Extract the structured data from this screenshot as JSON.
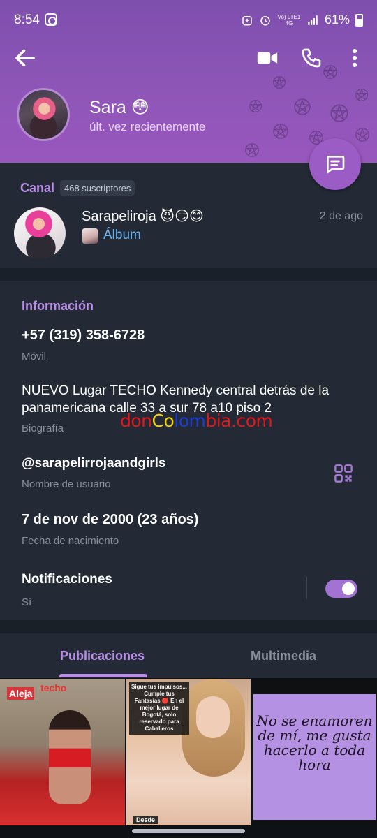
{
  "status_bar": {
    "time": "8:54",
    "network": "Vo) LTE1 4G",
    "battery": "61%"
  },
  "profile": {
    "name": "Sara 😳",
    "last_seen": "últ. vez recientemente"
  },
  "channel": {
    "label": "Canal",
    "subscribers": "468 suscriptores",
    "name": "Sarapeliroja 😈😏😊",
    "date": "2 de ago",
    "last_message": "Álbum"
  },
  "info": {
    "title": "Información",
    "phone": "+57 (319) 358-6728",
    "phone_label": "Móvil",
    "bio": "NUEVO Lugar TECHO Kennedy central detrás de la panamericana calle 33 a sur 78 a10 piso 2",
    "bio_label": "Biografía",
    "username": "@sarapelirrojaandgirls",
    "username_label": "Nombre de usuario",
    "birthdate": "7 de nov de 2000 (23 años)",
    "birthdate_label": "Fecha de nacimiento",
    "notifications": "Notificaciones",
    "notifications_value": "Sí",
    "notifications_enabled": true
  },
  "watermark": {
    "part1": "don",
    "part2": "Co",
    "part3": "lom",
    "part4": "bia.com"
  },
  "tabs": {
    "posts": "Publicaciones",
    "media": "Multimedia",
    "active": "posts"
  },
  "media": {
    "tile1_tag_left": "Aleja",
    "tile1_tag_right": "techo",
    "tile2_promo": "Sigue tus impulsos... Cumple tus Fantasías 🔴 En el mejor lugar de Bogotá, solo reservado para Caballeros",
    "tile2_footer": "Desde",
    "tile3_quote": "No se enamoren de mí, me gusta hacerlo a toda hora"
  },
  "colors": {
    "header": "#8f56b8",
    "accent": "#b98ee6",
    "link": "#6ab2f0",
    "background": "#1a2029",
    "section": "#232a35"
  },
  "icons": [
    "back-icon",
    "video-call-icon",
    "phone-call-icon",
    "more-vert-icon",
    "message-icon",
    "qr-code-icon"
  ]
}
